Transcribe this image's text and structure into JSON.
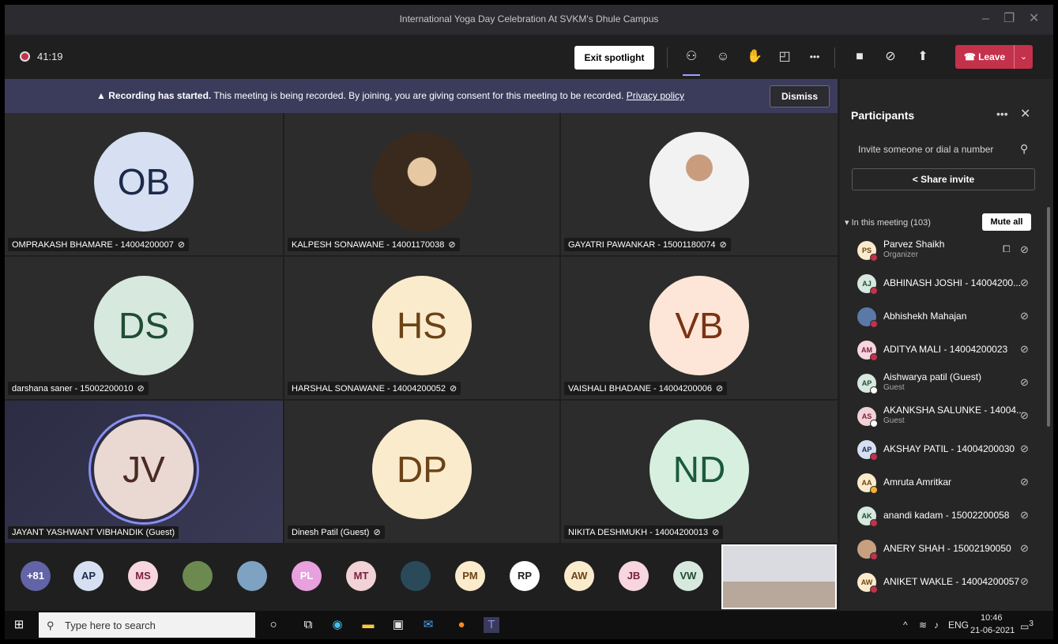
{
  "window": {
    "title": "International Yoga Day Celebration At SVKM's Dhule Campus"
  },
  "toolbar": {
    "timer": "41:19",
    "exit_spotlight": "Exit spotlight",
    "more": "•••",
    "leave": "Leave"
  },
  "banner": {
    "strong": "Recording has started.",
    "text": "This meeting is being recorded. By joining, you are giving consent for this meeting to be recorded.",
    "link": "Privacy policy",
    "dismiss": "Dismiss"
  },
  "tiles": [
    {
      "initials": "OB",
      "name": "OMPRAKASH BHAMARE - 14004200007",
      "bg": "#d6e0f2",
      "fg": "#1b2a4a"
    },
    {
      "initials": "",
      "name": "KALPESH SONAWANE - 14001170038",
      "bg": "",
      "fg": ""
    },
    {
      "initials": "",
      "name": "GAYATRI PAWANKAR - 15001180074",
      "bg": "",
      "fg": ""
    },
    {
      "initials": "DS",
      "name": "darshana saner - 15002200010",
      "bg": "#d7e8df",
      "fg": "#1f4d33"
    },
    {
      "initials": "HS",
      "name": "HARSHAL SONAWANE - 14004200052",
      "bg": "#fbebcd",
      "fg": "#6b4316"
    },
    {
      "initials": "VB",
      "name": "VAISHALI BHADANE - 14004200006",
      "bg": "#fde6d7",
      "fg": "#7a3312"
    },
    {
      "initials": "JV",
      "name": "JAYANT YASHWANT VIBHANDIK (Guest)",
      "bg": "#ead8d2",
      "fg": "#4a2a22"
    },
    {
      "initials": "DP",
      "name": "Dinesh Patil (Guest)",
      "bg": "#fbebcd",
      "fg": "#6b4316"
    },
    {
      "initials": "ND",
      "name": "NIKITA DESHMUKH - 14004200013",
      "bg": "#d7efdf",
      "fg": "#1a5a3a"
    }
  ],
  "strip": {
    "overflow": "+81",
    "chips": [
      {
        "t": "AP",
        "bg": "#d6e0f2",
        "fg": "#1b2a4a"
      },
      {
        "t": "MS",
        "bg": "#f7d6df",
        "fg": "#7a1f3c"
      },
      {
        "t": "",
        "bg": "#6c8a4f",
        "fg": "#fff"
      },
      {
        "t": "",
        "bg": "#7da2c2",
        "fg": "#fff"
      },
      {
        "t": "PL",
        "bg": "#e8a0de",
        "fg": "#fff"
      },
      {
        "t": "MT",
        "bg": "#f1d2d7",
        "fg": "#7a1f3c"
      },
      {
        "t": "",
        "bg": "#2a4a5a",
        "fg": "#fff"
      },
      {
        "t": "PM",
        "bg": "#fbebcd",
        "fg": "#6b4316"
      },
      {
        "t": "RP",
        "bg": "#ffffff",
        "fg": "#222"
      },
      {
        "t": "AW",
        "bg": "#fbebcd",
        "fg": "#6b4316"
      },
      {
        "t": "JB",
        "bg": "#f7d6df",
        "fg": "#7a1f3c"
      },
      {
        "t": "VW",
        "bg": "#d7e8df",
        "fg": "#1f4d33"
      }
    ]
  },
  "panel": {
    "title": "Participants",
    "search_placeholder": "Invite someone or dial a number",
    "share": "Share invite",
    "in_meeting": "In this meeting (103)",
    "mute_all": "Mute all",
    "people": [
      {
        "i": "PS",
        "name": "Parvez Shaikh",
        "sub": "Organizer",
        "bg": "#fbebcd",
        "fg": "#6b4316",
        "status": "#c4314b"
      },
      {
        "i": "AJ",
        "name": "ABHINASH JOSHI - 14004200...",
        "sub": "",
        "bg": "#d7e8df",
        "fg": "#1f4d33",
        "status": "#c4314b"
      },
      {
        "i": "",
        "name": "Abhishekh Mahajan",
        "sub": "",
        "bg": "#5a78a8",
        "fg": "#fff",
        "status": "#c4314b"
      },
      {
        "i": "AM",
        "name": "ADITYA MALI - 14004200023",
        "sub": "",
        "bg": "#f7d6df",
        "fg": "#7a1f3c",
        "status": "#c4314b"
      },
      {
        "i": "AP",
        "name": "Aishwarya patil (Guest)",
        "sub": "Guest",
        "bg": "#d7e8df",
        "fg": "#1f4d33",
        "status": "#ffffff"
      },
      {
        "i": "AS",
        "name": "AKANKSHA SALUNKE - 14004...",
        "sub": "Guest",
        "bg": "#f1d2d7",
        "fg": "#7a1f3c",
        "status": "#ffffff"
      },
      {
        "i": "AP",
        "name": "AKSHAY PATIL - 14004200030",
        "sub": "",
        "bg": "#d6e0f2",
        "fg": "#1b2a4a",
        "status": "#c4314b"
      },
      {
        "i": "AA",
        "name": "Amruta Amritkar",
        "sub": "",
        "bg": "#fbebcd",
        "fg": "#6b4316",
        "status": "#f8b12a"
      },
      {
        "i": "AK",
        "name": "anandi kadam - 15002200058",
        "sub": "",
        "bg": "#d7e8df",
        "fg": "#1f4d33",
        "status": "#c4314b"
      },
      {
        "i": "",
        "name": "ANERY SHAH - 15002190050",
        "sub": "",
        "bg": "#c8a080",
        "fg": "#fff",
        "status": "#c4314b"
      },
      {
        "i": "AW",
        "name": "ANIKET WAKLE - 14004200057",
        "sub": "",
        "bg": "#fbebcd",
        "fg": "#6b4316",
        "status": "#c4314b"
      }
    ]
  },
  "taskbar": {
    "search": "Type here to search",
    "lang": "ENG",
    "time": "10:46",
    "date": "21-06-2021",
    "badge": "3"
  }
}
